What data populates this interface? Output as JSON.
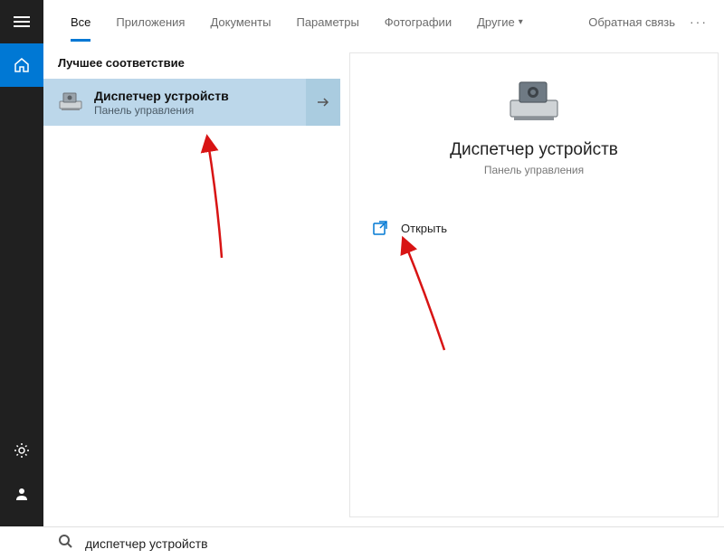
{
  "sidebar": {
    "items": [
      "menu",
      "home",
      "settings",
      "user"
    ]
  },
  "tabs": {
    "items": [
      {
        "label": "Все",
        "active": true
      },
      {
        "label": "Приложения",
        "active": false
      },
      {
        "label": "Документы",
        "active": false
      },
      {
        "label": "Параметры",
        "active": false
      },
      {
        "label": "Фотографии",
        "active": false
      },
      {
        "label": "Другие",
        "active": false,
        "dropdown": true
      }
    ],
    "feedback": "Обратная связь"
  },
  "results": {
    "section_header": "Лучшее соответствие",
    "items": [
      {
        "title": "Диспетчер устройств",
        "subtitle": "Панель управления"
      }
    ]
  },
  "detail": {
    "title": "Диспетчер устройств",
    "subtitle": "Панель управления",
    "actions": [
      {
        "icon": "open-icon",
        "label": "Открыть"
      }
    ]
  },
  "search": {
    "value": "диспетчер устройств",
    "placeholder": ""
  }
}
